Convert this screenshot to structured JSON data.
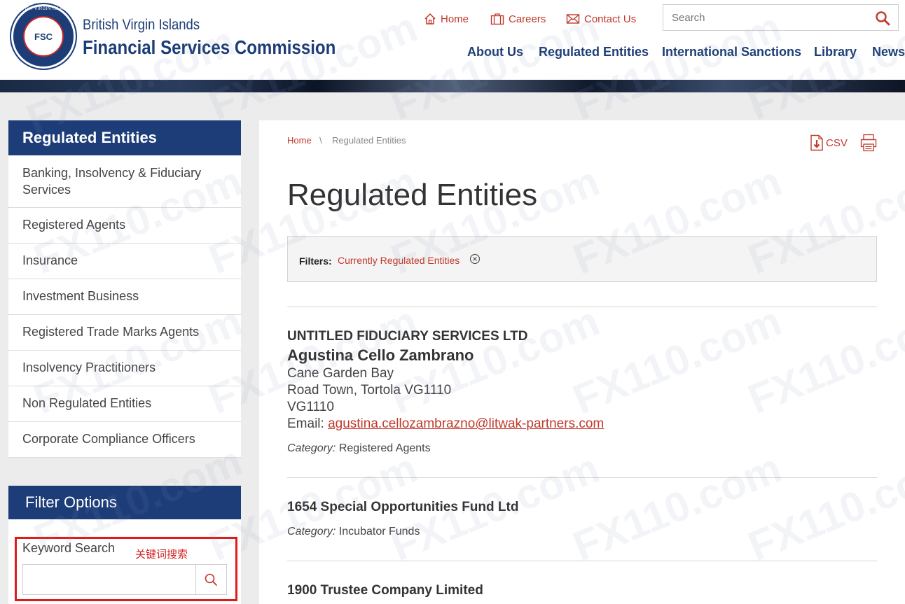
{
  "header": {
    "brand_line1": "British Virgin Islands",
    "brand_line2": "Financial Services Commission",
    "logo_ring_text": "BRITISH VIRGIN ISLANDS",
    "logo_monogram": "FSC",
    "util_links": [
      {
        "label": "Home",
        "icon": "house-icon"
      },
      {
        "label": "Careers",
        "icon": "briefcase-icon"
      },
      {
        "label": "Contact Us",
        "icon": "envelope-icon"
      }
    ],
    "search_placeholder": "Search",
    "main_nav": [
      "About Us",
      "Regulated Entities",
      "International Sanctions",
      "Library",
      "News"
    ]
  },
  "sidebar": {
    "title": "Regulated Entities",
    "items": [
      "Banking, Insolvency & Fiduciary Services",
      "Registered Agents",
      "Insurance",
      "Investment Business",
      "Registered Trade Marks Agents",
      "Insolvency Practitioners",
      "Non Regulated Entities",
      "Corporate Compliance Officers"
    ],
    "filter_title": "Filter Options",
    "keyword_label": "Keyword Search",
    "keyword_note": "关键词搜索",
    "keyword_value": ""
  },
  "breadcrumb": {
    "home": "Home",
    "separator": "\\",
    "current": "Regulated Entities"
  },
  "toolbar": {
    "csv_label": "CSV"
  },
  "page_title": "Regulated Entities",
  "filters": {
    "label": "Filters:",
    "value": "Currently Regulated Entities"
  },
  "entities": [
    {
      "name": "UNTITLED FIDUCIARY SERVICES LTD",
      "person": "Agustina Cello Zambrano",
      "address": [
        "Cane Garden Bay",
        "Road Town, Tortola VG1110",
        "VG1110"
      ],
      "email_label": "Email:",
      "email": "agustina.cellozambrazno@litwak-partners.com",
      "category_label": "Category:",
      "category": "Registered Agents"
    },
    {
      "name": "1654 Special Opportunities Fund Ltd",
      "category_label": "Category:",
      "category": "Incubator Funds"
    },
    {
      "name": "1900 Trustee Company Limited"
    }
  ],
  "colors": {
    "navy": "#1d3d78",
    "accent_red": "#c0392b",
    "annotation_red": "#e01b1b"
  },
  "watermark": "FX110.com"
}
